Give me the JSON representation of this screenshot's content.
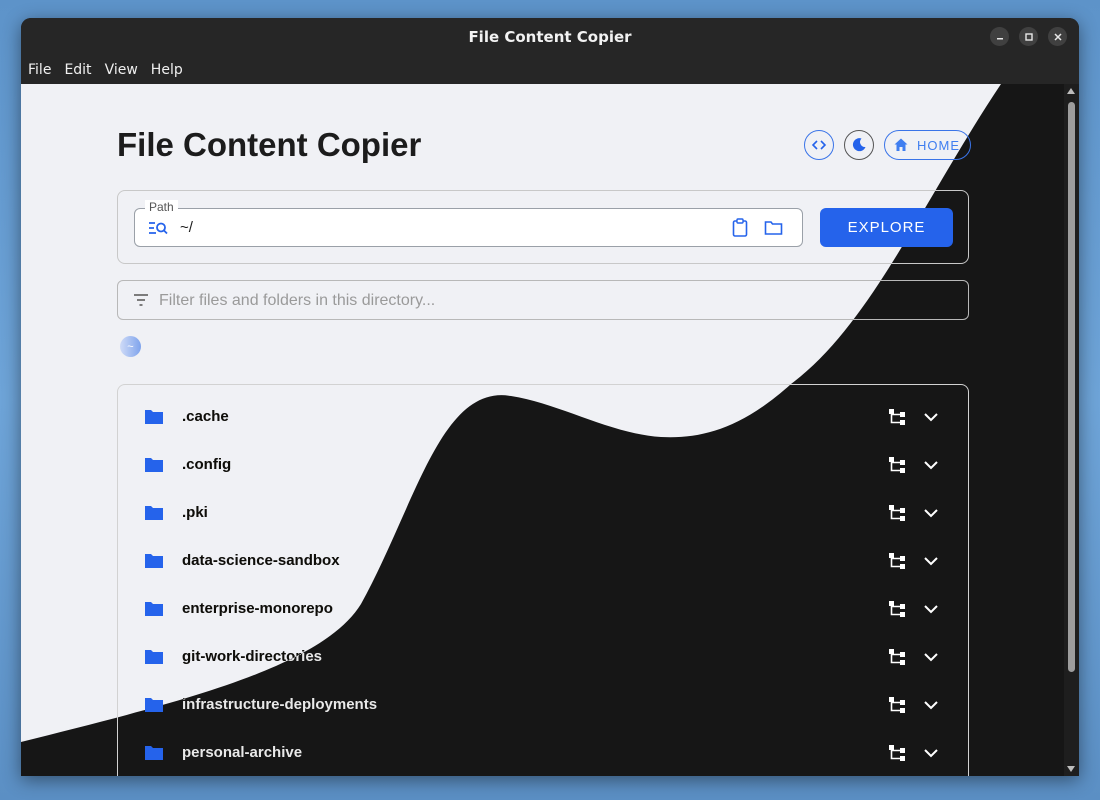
{
  "window": {
    "title": "File Content Copier"
  },
  "menu": {
    "items": [
      "File",
      "Edit",
      "View",
      "Help"
    ]
  },
  "header": {
    "title": "File Content Copier",
    "home_label": "HOME",
    "icons": [
      "code-icon",
      "moon-icon",
      "home-icon"
    ]
  },
  "path": {
    "label": "Path",
    "value": "~/",
    "explore_label": "EXPLORE"
  },
  "filter": {
    "placeholder": "Filter files and folders in this directory..."
  },
  "breadcrumb": {
    "chip": "~"
  },
  "folders": [
    {
      "name": ".cache"
    },
    {
      "name": ".config"
    },
    {
      "name": ".pki"
    },
    {
      "name": "data-science-sandbox"
    },
    {
      "name": "enterprise-monorepo"
    },
    {
      "name": "git-work-directories"
    },
    {
      "name": "infrastructure-deployments"
    },
    {
      "name": "personal-archive"
    }
  ],
  "colors": {
    "accent": "#2563eb",
    "light_bg": "#f0f1f5",
    "dark_bg": "#161616"
  }
}
